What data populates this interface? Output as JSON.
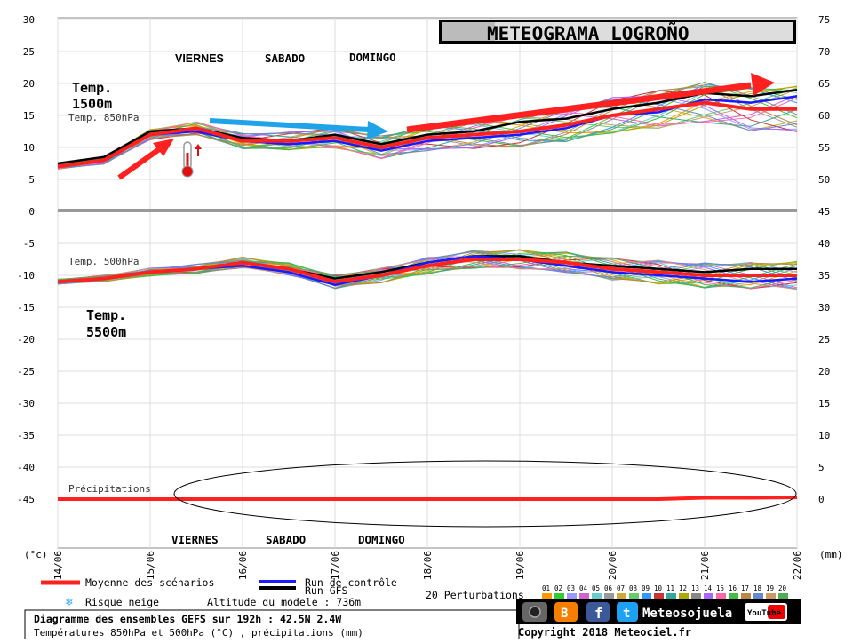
{
  "title": "METEOGRAMA LOGROÑO",
  "day_labels_top": [
    "VIERNES",
    "SABADO",
    "DOMINGO"
  ],
  "day_labels_bottom": [
    "VIERNES",
    "SABADO",
    "DOMINGO"
  ],
  "annotations": {
    "temp1500": [
      "Temp.",
      "1500m"
    ],
    "temp5500": [
      "Temp.",
      "5500m"
    ]
  },
  "panel_labels": {
    "t850": "Temp. 850hPa",
    "t500": "Temp. 500hPa",
    "precip": "Précipitations"
  },
  "axes": {
    "left_unit": "(°c)",
    "right_unit": "(mm)",
    "left_ticks": [
      30,
      25,
      20,
      15,
      10,
      5,
      0,
      -5,
      -10,
      -15,
      -20,
      -25,
      -30,
      -35,
      -40,
      -45
    ],
    "right_ticks": [
      75,
      70,
      65,
      60,
      55,
      50,
      45,
      40,
      35,
      30,
      25,
      20,
      15,
      10,
      5,
      0
    ],
    "x_ticks": [
      "14/06",
      "15/06",
      "16/06",
      "17/06",
      "18/06",
      "19/06",
      "20/06",
      "21/06",
      "22/06"
    ]
  },
  "legend": {
    "mean": "Moyenne des scénarios",
    "control": "Run de contrôle",
    "gfs": "Run GFS",
    "snow": "Risque neige",
    "altitude": "Altitude du modele : 736m",
    "perturbations": "20 Perturbations",
    "perturbation_ids": [
      "01",
      "02",
      "03",
      "04",
      "05",
      "06",
      "07",
      "08",
      "09",
      "10",
      "11",
      "12",
      "13",
      "14",
      "15",
      "16",
      "17",
      "18",
      "19",
      "20"
    ]
  },
  "footer": {
    "line1": "Diagramme des ensembles GEFS sur 192h : 42.5N 2.4W",
    "line2": "Températures 850hPa et 500hPa (°C) , précipitations (mm)",
    "brand": "Meteosojuela",
    "youtube": "YouTube",
    "copyright": "Copyright 2018 Meteociel.fr"
  },
  "colors": {
    "mean": "#ff2020",
    "control": "#1a1aff",
    "gfs": "#000000",
    "arrow_red": "#ff2020",
    "arrow_blue": "#1ea3e8"
  },
  "chart_data": {
    "type": "line",
    "title": "Diagramme des ensembles GEFS sur 192h : 42.5N 2.4W",
    "xlabel": "",
    "ylabel": "(°c)",
    "y2label": "(mm)",
    "ylim": [
      -50,
      30
    ],
    "y2lim": [
      -5,
      75
    ],
    "x": [
      "14/06 00",
      "14/06 12",
      "15/06 00",
      "15/06 12",
      "16/06 00",
      "16/06 12",
      "17/06 00",
      "17/06 12",
      "18/06 00",
      "18/06 12",
      "19/06 00",
      "19/06 12",
      "20/06 00",
      "20/06 12",
      "21/06 00",
      "21/06 12",
      "22/06 00"
    ],
    "series": [
      {
        "name": "Temp. 850hPa - Moyenne des scénarios",
        "values": [
          7,
          8,
          12,
          13,
          11,
          11,
          11.5,
          10,
          11.5,
          12,
          12.5,
          13.5,
          15,
          16,
          17,
          16,
          16
        ]
      },
      {
        "name": "Temp. 850hPa - Run de contrôle",
        "values": [
          7,
          8,
          12,
          12.5,
          11,
          10.5,
          11,
          9.5,
          11,
          11.5,
          12,
          13,
          15,
          15.5,
          17.5,
          17,
          18
        ]
      },
      {
        "name": "Temp. 850hPa - Run GFS",
        "values": [
          7.5,
          8.5,
          12.5,
          13,
          11.5,
          11,
          12,
          10.5,
          12,
          12.5,
          14,
          14.5,
          16,
          17,
          18.5,
          18,
          19
        ]
      },
      {
        "name": "Temp. 500hPa - Moyenne des scénarios",
        "values": [
          -11,
          -10.5,
          -9.5,
          -9,
          -8,
          -9,
          -11,
          -10,
          -8.5,
          -7.5,
          -7.5,
          -8,
          -9,
          -9.5,
          -10,
          -10,
          -10
        ]
      },
      {
        "name": "Temp. 500hPa - Run de contrôle",
        "values": [
          -11,
          -10.5,
          -9.5,
          -9,
          -8.5,
          -9.5,
          -11.5,
          -10,
          -8,
          -7,
          -7.5,
          -8.5,
          -9.5,
          -10,
          -10.5,
          -11,
          -10.5
        ]
      },
      {
        "name": "Temp. 500hPa - Run GFS",
        "values": [
          -11,
          -10.5,
          -9.5,
          -9,
          -8,
          -9,
          -10.5,
          -9.5,
          -8,
          -7,
          -7,
          -8,
          -8.5,
          -9,
          -9.5,
          -9,
          -9
        ]
      },
      {
        "name": "Précipitations - Moyenne des scénarios",
        "axis": "right",
        "values": [
          0,
          0,
          0,
          0,
          0,
          0,
          0,
          0,
          0,
          0,
          0,
          0,
          0,
          0,
          0.3,
          0.3,
          0.4
        ]
      }
    ],
    "grid": true
  }
}
